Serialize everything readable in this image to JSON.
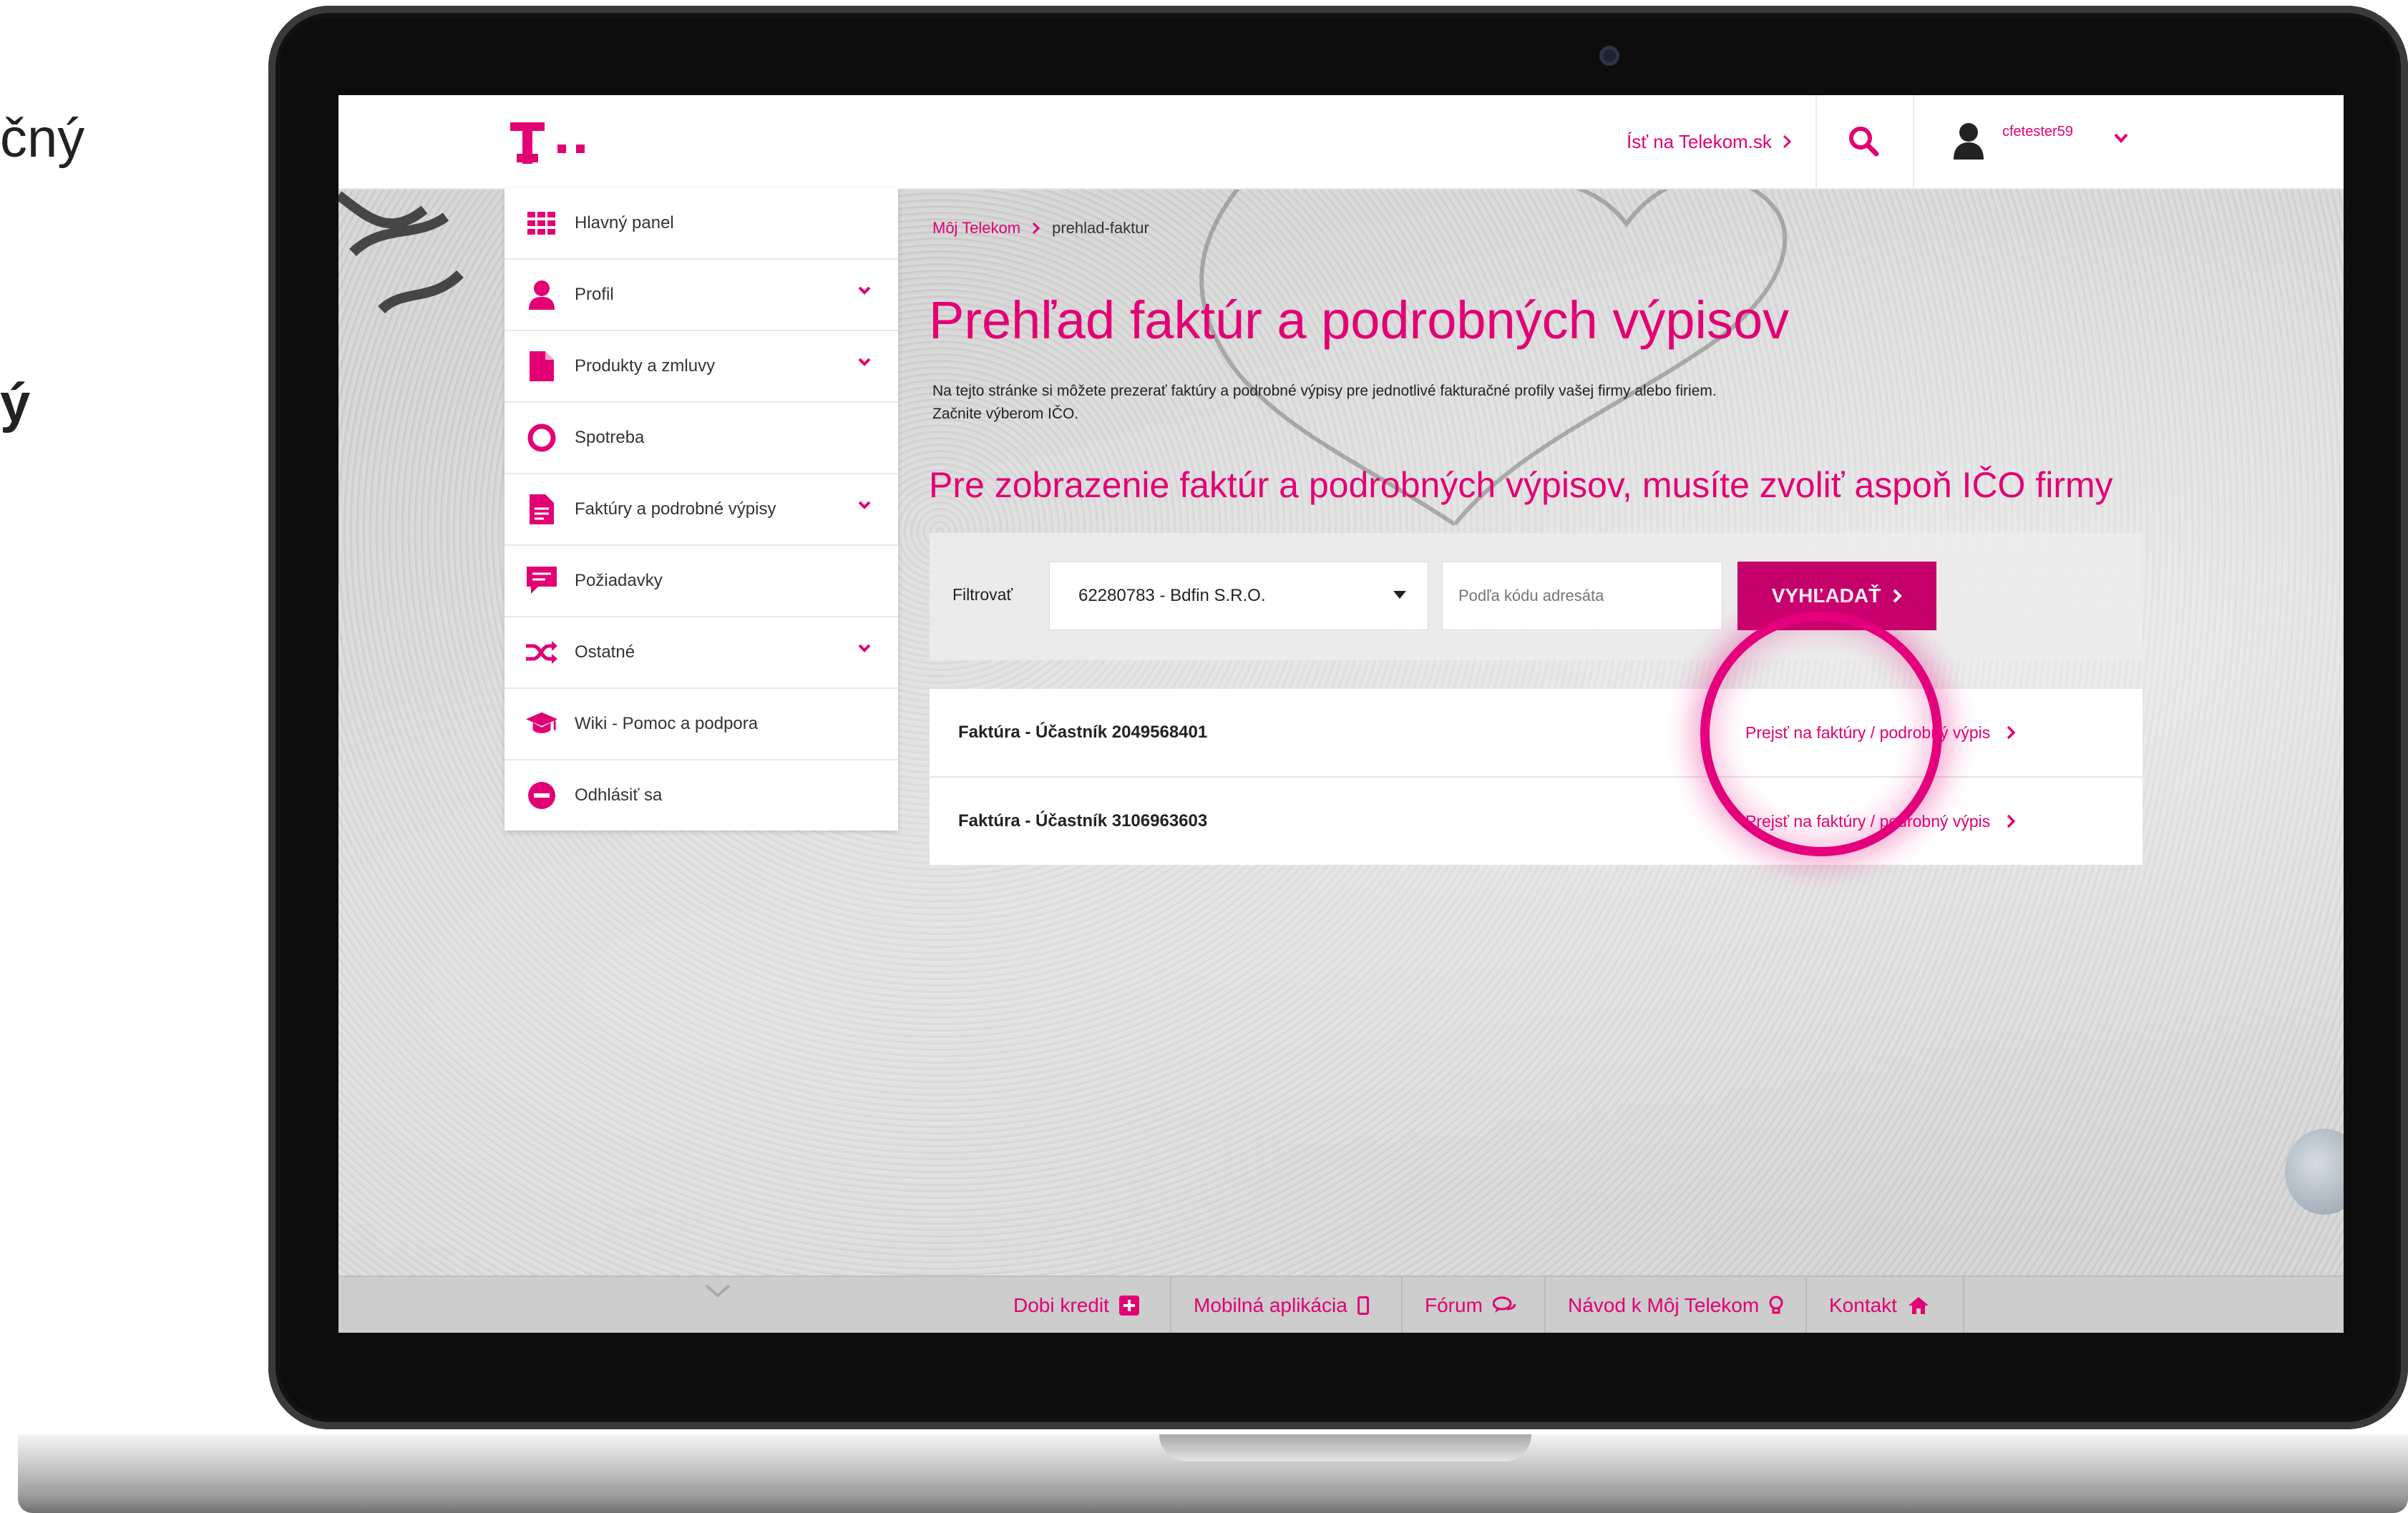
{
  "slide": {
    "left_text_1": "čný",
    "left_text_2": "ý"
  },
  "header": {
    "telekom_link": "Ísť na Telekom.sk",
    "username": "cfetester59"
  },
  "sidebar": {
    "items": [
      {
        "label": "Hlavný panel",
        "icon": "grid-icon",
        "has_chevron": false
      },
      {
        "label": "Profil",
        "icon": "person-icon",
        "has_chevron": true
      },
      {
        "label": "Produkty a zmluvy",
        "icon": "document-icon",
        "has_chevron": true
      },
      {
        "label": "Spotreba",
        "icon": "ring-icon",
        "has_chevron": false
      },
      {
        "label": "Faktúry a podrobné výpisy",
        "icon": "invoice-icon",
        "has_chevron": true
      },
      {
        "label": "Požiadavky",
        "icon": "chat-icon",
        "has_chevron": false
      },
      {
        "label": "Ostatné",
        "icon": "shuffle-icon",
        "has_chevron": true
      },
      {
        "label": "Wiki - Pomoc a podpora",
        "icon": "graduation-cap-icon",
        "has_chevron": false
      },
      {
        "label": "Odhlásiť sa",
        "icon": "minus-circle-icon",
        "has_chevron": false
      }
    ]
  },
  "breadcrumb": {
    "home": "Môj Telekom",
    "current": "prehlad-faktur"
  },
  "main": {
    "title": "Prehľad faktúr a podrobných výpisov",
    "description_1": "Na tejto stránke si môžete prezerať faktúry a podrobné výpisy pre jednotlivé fakturačné profily vašej firmy alebo firiem.",
    "description_2": "Začnite výberom IČO.",
    "subtitle": "Pre zobrazenie faktúr a podrobných výpisov, musíte zvoliť aspoň IČO firmy"
  },
  "filter": {
    "label": "Filtrovať",
    "selected_company": "62280783 - Bdfin S.R.O.",
    "input_placeholder": "Podľa kódu adresáta",
    "search_button": "VYHĽADAŤ"
  },
  "results": [
    {
      "title": "Faktúra - Účastník 2049568401",
      "link": "Prejsť na faktúry / podrobný výpis"
    },
    {
      "title": "Faktúra - Účastník 3106963603",
      "link": "Prejsť na faktúry / podrobný výpis"
    }
  ],
  "footer": {
    "items": [
      {
        "label": "Dobi kredit",
        "icon": "plus-square-icon"
      },
      {
        "label": "Mobilná aplikácia",
        "icon": "phone-icon"
      },
      {
        "label": "Fórum",
        "icon": "comments-icon"
      },
      {
        "label": "Návod k Môj Telekom",
        "icon": "lightbulb-icon"
      },
      {
        "label": "Kontakt",
        "icon": "home-icon"
      }
    ]
  },
  "colors": {
    "brand": "#e20074",
    "button": "#c4006b",
    "highlight": "#e4007c"
  }
}
